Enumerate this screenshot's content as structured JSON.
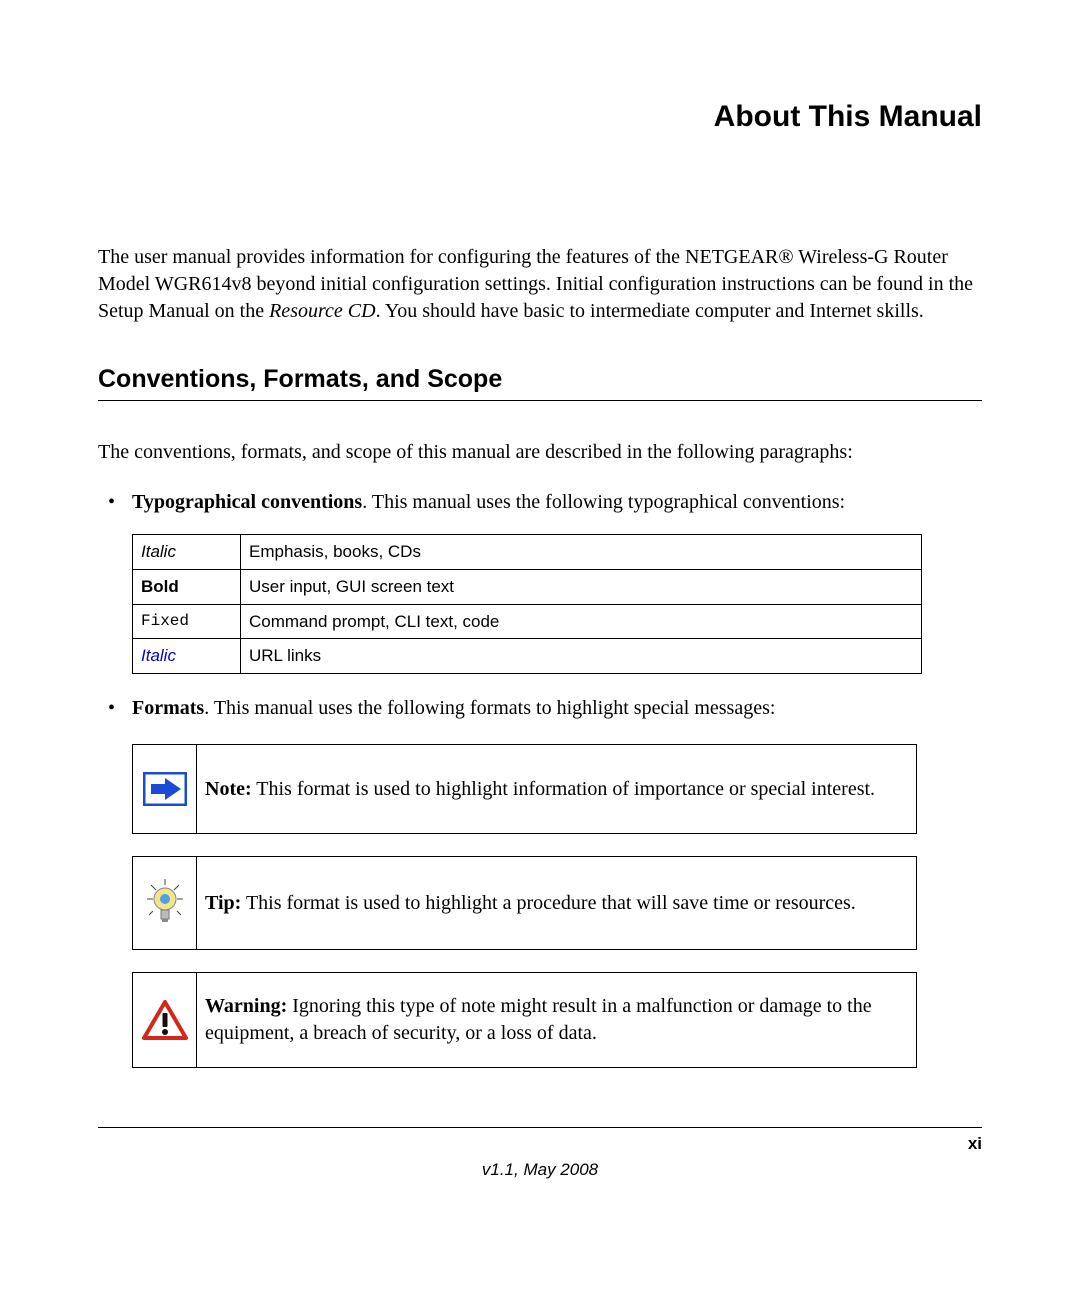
{
  "title": "About This Manual",
  "intro_part1": "The user manual provides information for configuring the features of the NETGEAR® Wireless-G Router Model WGR614v8 beyond initial configuration settings. Initial configuration instructions can be found in the Setup Manual on the ",
  "intro_italic": "Resource CD",
  "intro_part2": ". You should have basic to intermediate computer and Internet skills.",
  "section_heading": "Conventions, Formats, and Scope",
  "section_intro": "The conventions, formats, and scope of this manual are described in the following paragraphs:",
  "bullet1_label": "Typographical conventions",
  "bullet1_text": ". This manual uses the following typographical conventions:",
  "conv_table": [
    {
      "left": "Italic",
      "right": "Emphasis, books, CDs"
    },
    {
      "left": "Bold",
      "right": "User input, GUI screen text"
    },
    {
      "left": "Fixed",
      "right": "Command prompt, CLI text, code"
    },
    {
      "left": "Italic",
      "right": "URL links"
    }
  ],
  "bullet2_label": "Formats",
  "bullet2_text": ". This manual uses the following formats to highlight special messages:",
  "note_label": "Note:",
  "note_text": " This format is used to highlight information of importance or special interest.",
  "tip_label": "Tip:",
  "tip_text": " This format is used to highlight a procedure that will save time or resources.",
  "warning_label": "Warning:",
  "warning_text": " Ignoring this type of note might result in a malfunction or damage to the equipment, a breach of security, or a loss of data.",
  "page_number": "xi",
  "version": "v1.1, May 2008"
}
